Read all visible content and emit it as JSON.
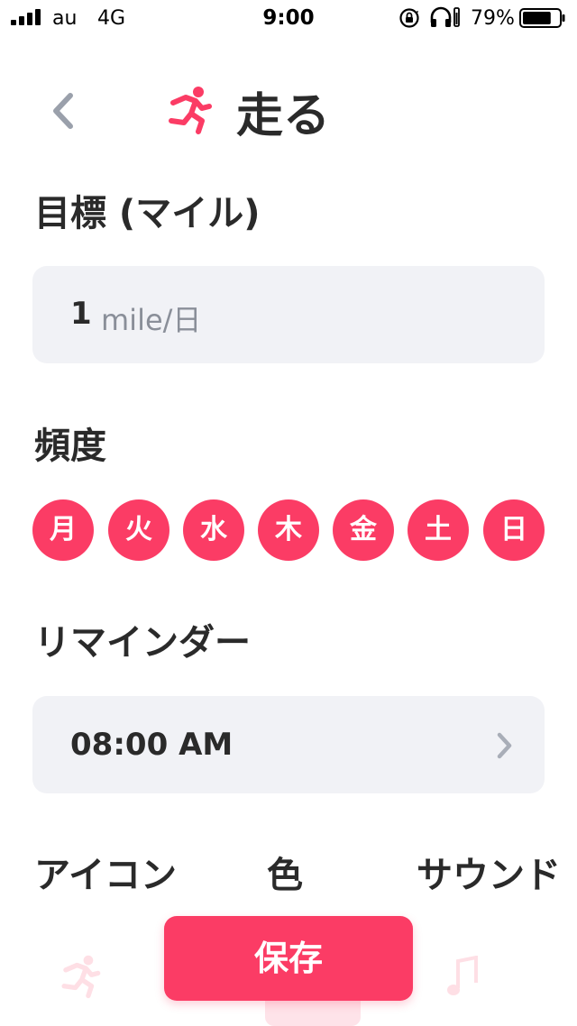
{
  "status_bar": {
    "carrier": "au",
    "network": "4G",
    "time": "9:00",
    "battery_percent": "79%",
    "battery_level": 0.79
  },
  "header": {
    "title": "走る",
    "back_icon": "chevron-left-icon",
    "activity_icon": "running-person-icon"
  },
  "goal": {
    "label": "目標 (マイル)",
    "value": "1",
    "unit": "mile/日"
  },
  "frequency": {
    "label": "頻度",
    "days": [
      "月",
      "火",
      "水",
      "木",
      "金",
      "土",
      "日"
    ]
  },
  "reminder": {
    "label": "リマインダー",
    "time": "08:00 AM"
  },
  "options": {
    "icon_label": "アイコン",
    "color_label": "色",
    "sound_label": "サウンド"
  },
  "save_label": "保存",
  "colors": {
    "accent": "#fb3c65",
    "field_bg": "#f1f2f6",
    "text": "#2a2a2a",
    "muted": "#8a8f99"
  }
}
